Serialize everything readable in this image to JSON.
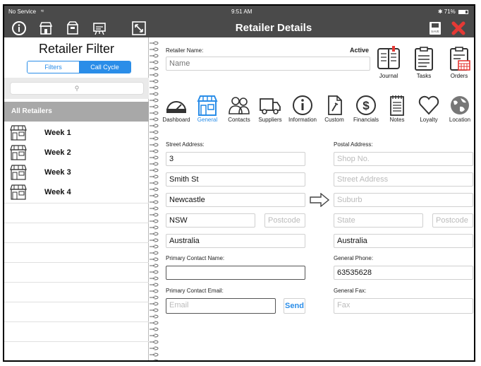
{
  "status": {
    "carrier": "No Service",
    "time": "9:51 AM",
    "battery": "71%"
  },
  "header": {
    "title": "Retailer Details"
  },
  "toolbar_left_icons": [
    "info-icon",
    "store-icon",
    "box-icon",
    "projector-icon",
    "resize-icon"
  ],
  "toolbar_right_icons": [
    "save-icon",
    "close-icon"
  ],
  "toolbar": {
    "save_label": "SAVE"
  },
  "sidebar": {
    "title": "Retailer Filter",
    "segments": [
      {
        "label": "Filters",
        "active": false
      },
      {
        "label": "Call Cycle",
        "active": true
      }
    ],
    "all_retailers": "All Retailers",
    "items": [
      {
        "label": "Week 1"
      },
      {
        "label": "Week 2"
      },
      {
        "label": "Week 3"
      },
      {
        "label": "Week 4"
      }
    ]
  },
  "retailer": {
    "name_label": "Retailer Name:",
    "name_placeholder": "Name",
    "status": "Active"
  },
  "top_actions": [
    {
      "label": "Journal",
      "icon": "journal-icon"
    },
    {
      "label": "Tasks",
      "icon": "tasks-icon"
    },
    {
      "label": "Orders",
      "icon": "orders-icon"
    }
  ],
  "nav": [
    {
      "label": "Dashboard",
      "icon": "dashboard-icon",
      "active": false
    },
    {
      "label": "General",
      "icon": "store-icon",
      "active": true
    },
    {
      "label": "Contacts",
      "icon": "contacts-icon",
      "active": false
    },
    {
      "label": "Suppliers",
      "icon": "truck-icon",
      "active": false
    },
    {
      "label": "Information",
      "icon": "info-icon",
      "active": false
    },
    {
      "label": "Custom",
      "icon": "custom-icon",
      "active": false
    },
    {
      "label": "Financials",
      "icon": "dollar-icon",
      "active": false
    },
    {
      "label": "Notes",
      "icon": "notes-icon",
      "active": false
    },
    {
      "label": "Loyalty",
      "icon": "heart-icon",
      "active": false
    },
    {
      "label": "Location",
      "icon": "globe-icon",
      "active": false
    }
  ],
  "street": {
    "label": "Street Address:",
    "line1": "3",
    "line2": "Smith St",
    "suburb": "Newcastle",
    "state": "NSW",
    "postcode_placeholder": "Postcode",
    "country": "Australia"
  },
  "postal": {
    "label": "Postal Address:",
    "shop_placeholder": "Shop No.",
    "street_placeholder": "Street Address",
    "suburb_placeholder": "Suburb",
    "state_placeholder": "State",
    "postcode_placeholder": "Postcode",
    "country": "Australia"
  },
  "contact": {
    "name_label": "Primary Contact Name:",
    "name_value": "",
    "email_label": "Primary Contact Email:",
    "email_placeholder": "Email",
    "send_label": "Send",
    "phone_label": "General Phone:",
    "phone_value": "63535628",
    "fax_label": "General Fax:",
    "fax_placeholder": "Fax"
  },
  "colors": {
    "accent": "#2a8de8",
    "header_bg": "#4a4a4a",
    "close_red": "#e53935"
  }
}
